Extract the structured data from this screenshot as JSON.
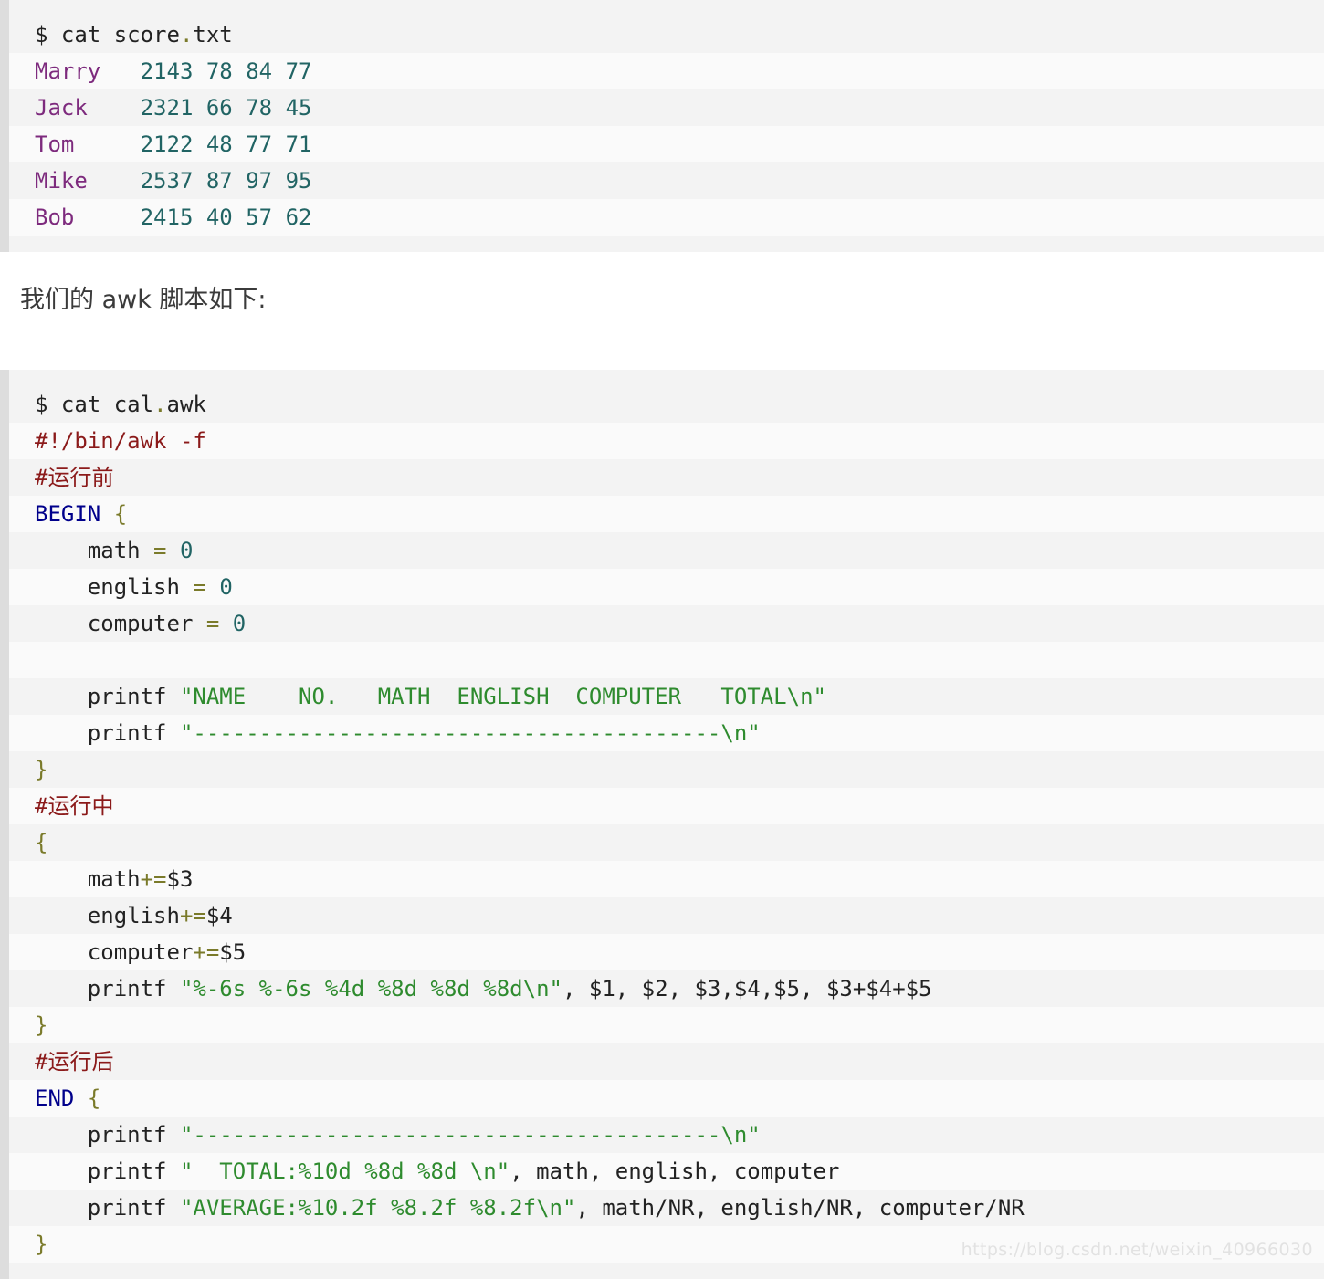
{
  "page": {
    "watermark": "https://blog.csdn.net/weixin_40966030",
    "accent_gutter": "#dddddd",
    "stripe_dark": "#f3f3f3",
    "stripe_light": "#fafafa"
  },
  "colors": {
    "identifier_purple": "#7d2a7d",
    "number_teal": "#216464",
    "string_green": "#2e8b2e",
    "comment_red": "#8b1a1a",
    "keyword_blue": "#00008b",
    "operator_olive": "#7a7a2a",
    "plain_text": "#222222"
  },
  "block_score": {
    "name": "score-file-listing",
    "command_prompt": "$",
    "command": "cat score.txt",
    "command_base": "score",
    "command_ext": "txt",
    "columns": [
      "name",
      "no",
      "math",
      "english",
      "computer"
    ],
    "rows": [
      {
        "name": "Marry",
        "no": "2143",
        "math": "78",
        "english": "84",
        "computer": "77"
      },
      {
        "name": "Jack",
        "no": "2321",
        "math": "66",
        "english": "78",
        "computer": "45"
      },
      {
        "name": "Tom",
        "no": "2122",
        "math": "48",
        "english": "77",
        "computer": "71"
      },
      {
        "name": "Mike",
        "no": "2537",
        "math": "87",
        "english": "97",
        "computer": "95"
      },
      {
        "name": "Bob",
        "no": "2415",
        "math": "40",
        "english": "57",
        "computer": "62"
      }
    ],
    "row_text": [
      "Marry   2143 78 84 77",
      "Jack    2321 66 78 45",
      "Tom     2122 48 77 71",
      "Mike    2537 87 97 95",
      "Bob     2415 40 57 62"
    ]
  },
  "prose": {
    "intro": "我们的 awk 脚本如下:"
  },
  "block_awk": {
    "name": "cal-awk-script-listing",
    "command_prompt": "$",
    "command": "cat cal.awk",
    "command_base": "cal",
    "command_ext": "awk",
    "shebang": "#!/bin/awk -f",
    "comment_before": "#运行前",
    "comment_during": "#运行中",
    "comment_after": "#运行后",
    "kw_begin": "BEGIN",
    "kw_end": "END",
    "brace_open": "{",
    "brace_close": "}",
    "init": [
      {
        "var": "math",
        "op": "=",
        "value": "0"
      },
      {
        "var": "english",
        "op": "=",
        "value": "0"
      },
      {
        "var": "computer",
        "op": "=",
        "value": "0"
      }
    ],
    "printf_kw": "printf",
    "header_string": "\"NAME    NO.   MATH  ENGLISH  COMPUTER   TOTAL\\n\"",
    "separator_string": "\"----------------------------------------\\n\"",
    "accumulate": [
      {
        "var": "math",
        "op": "+=",
        "field": "$3"
      },
      {
        "var": "english",
        "op": "+=",
        "field": "$4"
      },
      {
        "var": "computer",
        "op": "+=",
        "field": "$5"
      }
    ],
    "row_format_string": "\"%-6s %-6s %4d %8d %8d %8d\\n\"",
    "row_args": ", $1, $2, $3,$4,$5, $3+$4+$5",
    "total_format_string": "\"  TOTAL:%10d %8d %8d \\n\"",
    "total_args": ", math, english, computer",
    "average_format_string": "\"AVERAGE:%10.2f %8.2f %8.2f\\n\"",
    "average_args": ", math/NR, english/NR, computer/NR"
  }
}
